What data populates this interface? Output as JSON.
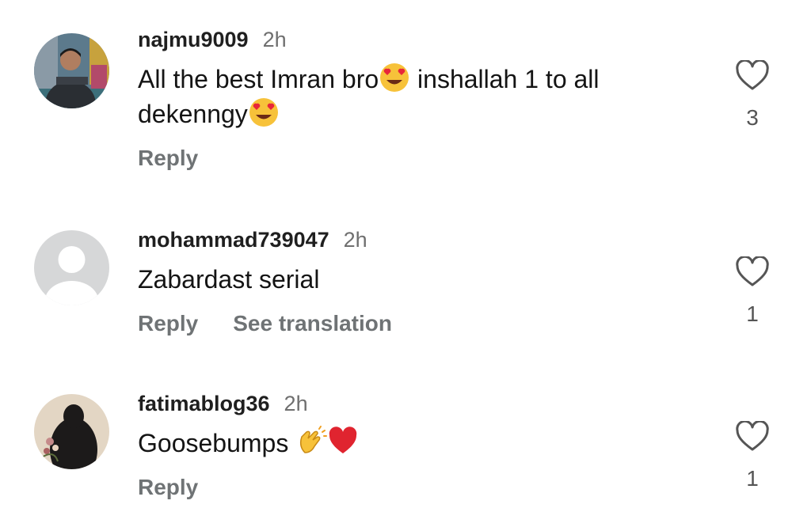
{
  "comments": [
    {
      "username": "najmu9009",
      "time": "2h",
      "text_part1": "All the best Imran bro",
      "text_emoji1": "heart-eyes",
      "text_part2": " inshallah 1 to all dekenngy",
      "text_emoji2": "heart-eyes",
      "reply_label": "Reply",
      "likes": "3"
    },
    {
      "username": "mohammad739047",
      "time": "2h",
      "text": "Zabardast serial",
      "reply_label": "Reply",
      "translate_label": "See translation",
      "likes": "1"
    },
    {
      "username": "fatimablog36",
      "time": "2h",
      "text_part1": "Goosebumps ",
      "text_emoji1": "clapping-hands",
      "text_emoji2": "red-heart",
      "reply_label": "Reply",
      "likes": "1"
    }
  ],
  "colors": {
    "username": "#1f1f1f",
    "secondary": "#6f7375",
    "heart_outline": "#555555"
  }
}
